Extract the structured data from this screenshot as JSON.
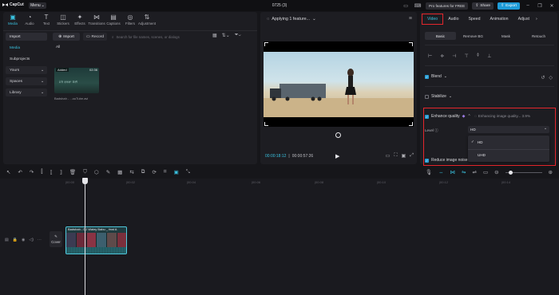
{
  "titlebar": {
    "app_name": "CapCut",
    "menu_label": "Menu",
    "project_title": "0725 (3)",
    "pro_label": "Pro features for FREE",
    "share_label": "Share",
    "export_label": "Export"
  },
  "media": {
    "tabs": [
      {
        "label": "Media",
        "icon": "media-icon"
      },
      {
        "label": "Audio",
        "icon": "audio-icon"
      },
      {
        "label": "Text",
        "icon": "text-icon"
      },
      {
        "label": "Stickers",
        "icon": "stickers-icon"
      },
      {
        "label": "Effects",
        "icon": "effects-icon"
      },
      {
        "label": "Transitions",
        "icon": "transitions-icon"
      },
      {
        "label": "Captions",
        "icon": "captions-icon"
      },
      {
        "label": "Filters",
        "icon": "filters-icon"
      },
      {
        "label": "Adjustment",
        "icon": "adjustment-icon"
      }
    ],
    "sidebar": [
      {
        "label": "Import"
      },
      {
        "label": "Media"
      },
      {
        "label": "Subprojects"
      },
      {
        "label": "Yours"
      },
      {
        "label": "Spaces"
      },
      {
        "label": "Library"
      }
    ],
    "import_label": "Import",
    "record_label": "Record",
    "search_placeholder": "Search for file names, scenes, or dialogs",
    "filter_all": "All",
    "thumb": {
      "added_badge": "Added",
      "duration": "02:36",
      "overlay_text": "ਮੇਰੇ ਵਰਗਾ ਕੋਈ",
      "filename": "Badshah - ...ouTube.avi"
    }
  },
  "player": {
    "title": "Applying 1 feature...",
    "time_current": "00:00:18:12",
    "time_total": "00:00:57:26"
  },
  "properties": {
    "tabs": [
      "Video",
      "Audio",
      "Speed",
      "Animation",
      "Adjust"
    ],
    "subtabs": [
      "Basic",
      "Remove BG",
      "Mask",
      "Retouch"
    ],
    "blend_label": "Blend",
    "stabilize_label": "Stabilize",
    "enhance_label": "Enhance quality",
    "enhance_progress": "Enhancing image quality... 3.9%",
    "level_label": "Level",
    "level_value": "HD",
    "level_options": [
      "HD",
      "UHD"
    ],
    "reduce_noise_label": "Reduce image noise"
  },
  "timeline": {
    "cover_label": "Cover",
    "clip_title": "Badshah - DJ Waley Babu _ feat A",
    "ruler_labels": [
      "|00:00",
      "|00:02",
      "|00:04",
      "|00:06",
      "|00:08",
      "|00:10",
      "|00:12",
      "|00:14",
      "|00:16",
      "|00:18",
      "|00:20"
    ]
  }
}
